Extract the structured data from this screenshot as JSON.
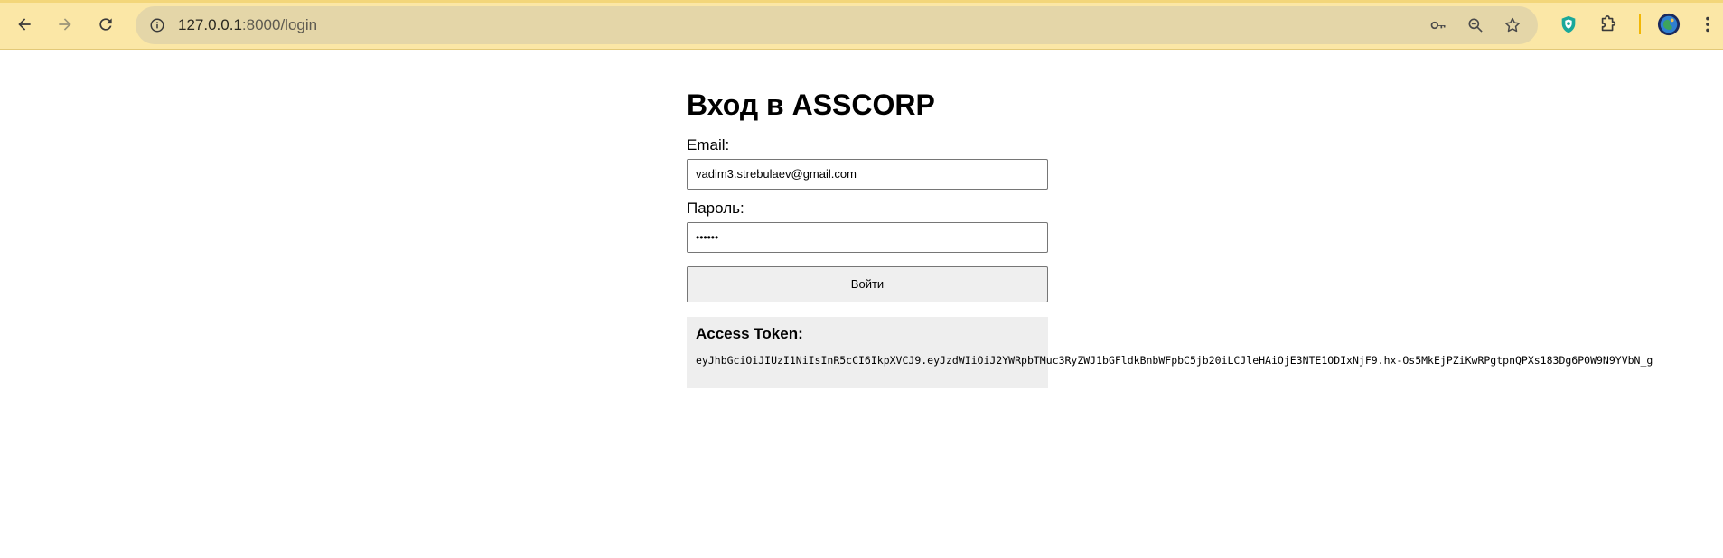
{
  "browser": {
    "url_host": "127.0.0.1",
    "url_path": ":8000/login",
    "icons": {
      "back": "arrow-left-icon",
      "forward": "arrow-right-icon",
      "reload": "reload-icon",
      "site_info": "info-icon",
      "password": "key-icon",
      "zoom": "zoom-out-icon",
      "bookmark": "star-icon",
      "extension_shield": "shield-icon",
      "extensions": "puzzle-icon",
      "profile": "avatar",
      "menu": "kebab-menu-icon"
    },
    "colors": {
      "toolbar": "#fbe7a6",
      "omnibox": "#e4d6a8",
      "divider": "#f2b705"
    }
  },
  "page": {
    "title": "Вход в ASSCORP",
    "email_label": "Email:",
    "email_value": "vadim3.strebulaev@gmail.com",
    "password_label": "Пароль:",
    "password_value": "••••••",
    "submit_label": "Войти",
    "token_title": "Access Token:",
    "token_value": "eyJhbGciOiJIUzI1NiIsInR5cCI6IkpXVCJ9.eyJzdWIiOiJ2YWRpbTMuc3RyZWJ1bGFldkBnbWFpbC5jb20iLCJleHAiOjE3NTE1ODIxNjF9.hx-Os5MkEjPZiKwRPgtpnQPXs183Dg6P0W9N9YVbN_g"
  }
}
